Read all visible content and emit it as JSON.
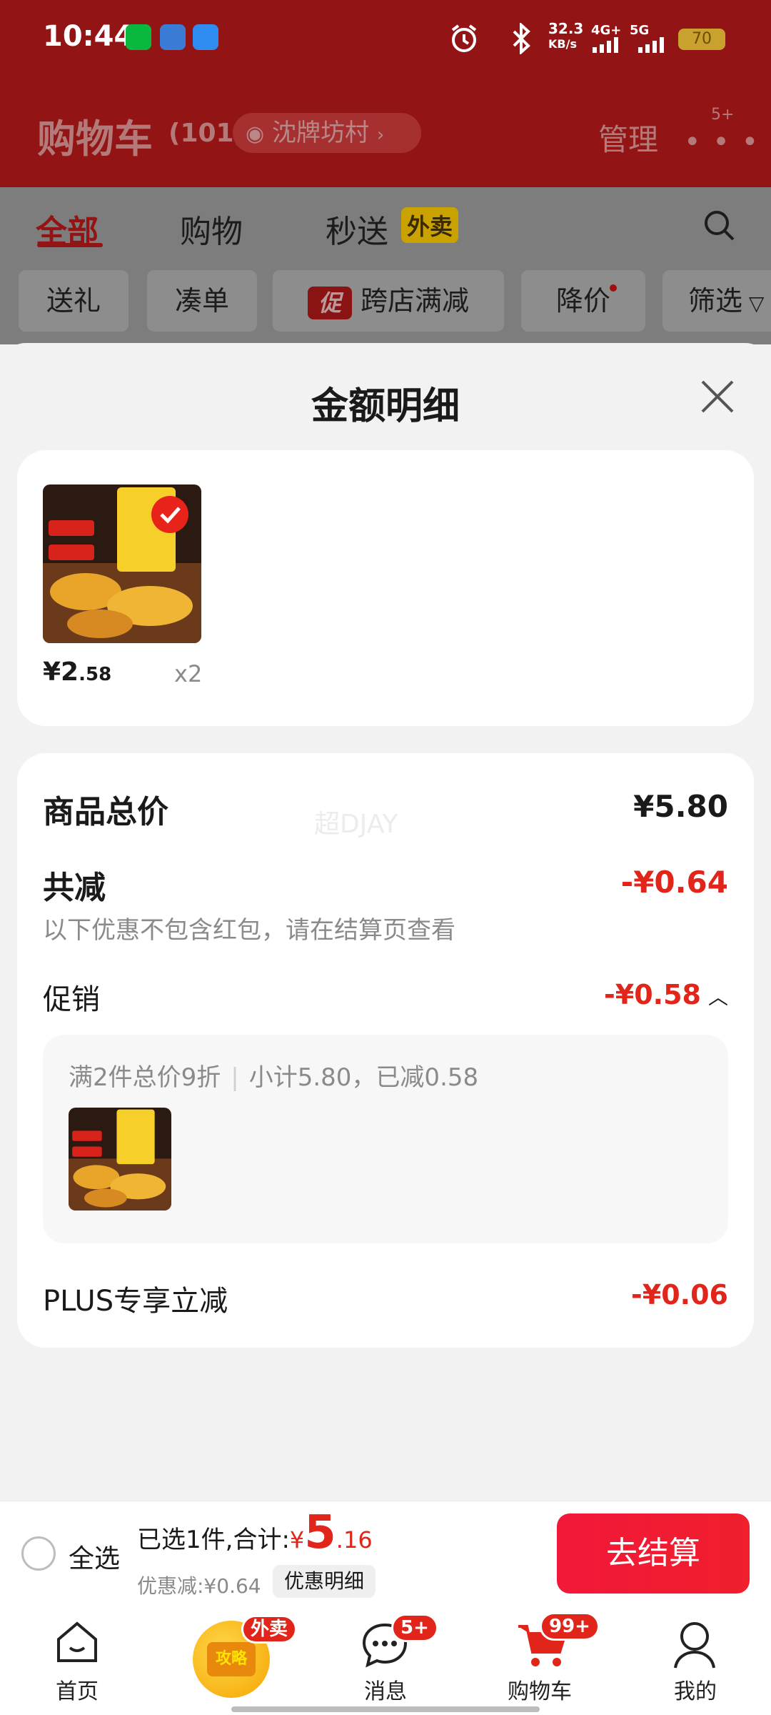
{
  "status_bar": {
    "time": "10:44",
    "net_speed": "32.3",
    "net_unit": "KB/s",
    "net_type_1": "4G+",
    "net_type_2": "5G",
    "battery": "70"
  },
  "header": {
    "title": "购物车",
    "count": "(101)",
    "location": "沈牌坊村",
    "manage": "管理",
    "more_badge": "5+"
  },
  "tabs": [
    {
      "label": "全部"
    },
    {
      "label": "购物"
    },
    {
      "label": "秒送"
    }
  ],
  "waimai_badge": "外卖",
  "chips": [
    {
      "label": "送礼"
    },
    {
      "label": "凑单"
    },
    {
      "label": "跨店满减",
      "tag": "促"
    },
    {
      "label": "降价"
    },
    {
      "label": "筛选"
    }
  ],
  "sheet": {
    "title": "金额明细",
    "item": {
      "price_int": "¥2",
      "price_dec": ".58",
      "qty": "x2"
    },
    "watermark": "超DJAY",
    "total_label": "商品总价",
    "total_value": "¥5.80",
    "reduce_label": "共减",
    "reduce_value": "-¥0.64",
    "reduce_note": "以下优惠不包含红包，请在结算页查看",
    "promo_label": "促销",
    "promo_value": "-¥0.58",
    "promo_rule": "满2件总价9折",
    "promo_subtotal": "小计5.80，已减0.58",
    "plus_label": "PLUS专享立减",
    "plus_value": "-¥0.06"
  },
  "checkout": {
    "select_all": "全选",
    "selected_text": "已选1件,合计:",
    "currency": "¥",
    "total_int": "5",
    "total_dec": ".16",
    "discount_text": "优惠减:¥0.64",
    "detail_button": "优惠明细",
    "checkout_button": "去结算"
  },
  "nav": [
    {
      "label": "首页",
      "icon": "home-icon"
    },
    {
      "label": "攻略",
      "icon": "guide-bag-icon",
      "badge": "外卖"
    },
    {
      "label": "消息",
      "icon": "message-icon",
      "badge": "5+"
    },
    {
      "label": "购物车",
      "icon": "cart-icon",
      "badge": "99+"
    },
    {
      "label": "我的",
      "icon": "profile-icon"
    }
  ],
  "colors": {
    "accent": "#e1251b",
    "header_dim": "#931414",
    "sheet_bg": "#f2f2f2"
  }
}
